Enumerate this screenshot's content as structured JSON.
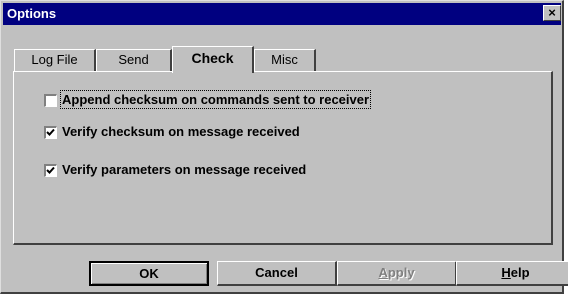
{
  "window": {
    "title": "Options",
    "close_glyph": "×"
  },
  "tabs": [
    {
      "label": "Log File",
      "active": false
    },
    {
      "label": "Send",
      "active": false
    },
    {
      "label": "Check",
      "active": true
    },
    {
      "label": "Misc",
      "active": false
    }
  ],
  "options": [
    {
      "label": "Append checksum on commands sent to receiver",
      "checked": false,
      "focused": true
    },
    {
      "label": "Verify checksum on message received",
      "checked": true,
      "focused": false
    },
    {
      "label": "Verify parameters on message received",
      "checked": true,
      "focused": false
    }
  ],
  "buttons": {
    "ok": "OK",
    "cancel": "Cancel",
    "apply_mnemonic": "A",
    "apply_rest": "pply",
    "help_mnemonic": "H",
    "help_rest": "elp"
  },
  "colors": {
    "titlebar": "#000080",
    "face": "#c0c0c0",
    "disabled_text": "#808080"
  }
}
